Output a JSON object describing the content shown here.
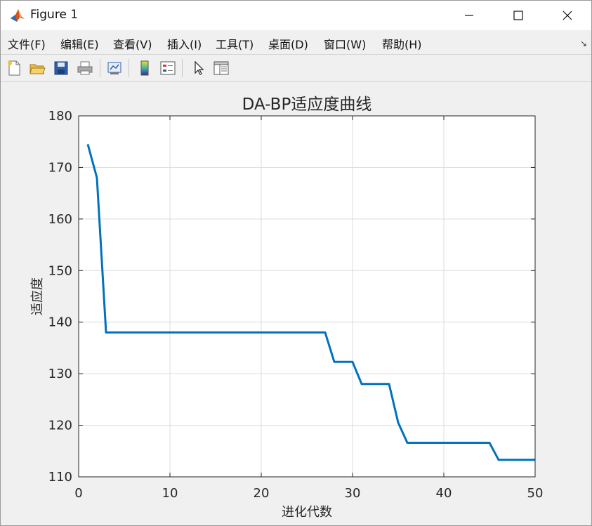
{
  "window": {
    "title": "Figure 1",
    "controls": {
      "minimize": "—",
      "maximize": "☐",
      "close": "✕"
    }
  },
  "menu": {
    "items": [
      "文件(F)",
      "编辑(E)",
      "查看(V)",
      "插入(I)",
      "工具(T)",
      "桌面(D)",
      "窗口(W)",
      "帮助(H)"
    ],
    "more_icon": "↘"
  },
  "toolbar": {
    "buttons": [
      "new-figure-icon",
      "open-file-icon",
      "save-icon",
      "print-icon",
      "link-plot-icon",
      "colorbar-icon",
      "legend-icon",
      "edit-plot-icon",
      "property-inspector-icon"
    ]
  },
  "colors": {
    "line": "#0072BD",
    "grid": "#dcdcdc",
    "axes_bg": "#ffffff",
    "figure_bg": "#f0f0f0"
  },
  "chart_data": {
    "type": "line",
    "title": "DA-BP适应度曲线",
    "xlabel": "进化代数",
    "ylabel": "适应度",
    "xlim": [
      0,
      50
    ],
    "ylim": [
      110,
      180
    ],
    "xticks": [
      0,
      10,
      20,
      30,
      40,
      50
    ],
    "yticks": [
      110,
      120,
      130,
      140,
      150,
      160,
      170,
      180
    ],
    "grid": true,
    "series": [
      {
        "x": [
          1,
          2,
          3,
          4,
          5,
          6,
          7,
          8,
          9,
          10,
          11,
          12,
          13,
          14,
          15,
          16,
          17,
          18,
          19,
          20,
          21,
          22,
          23,
          24,
          25,
          26,
          27,
          28,
          29,
          30,
          31,
          32,
          33,
          34,
          35,
          36,
          37,
          38,
          39,
          40,
          41,
          42,
          43,
          44,
          45,
          46,
          47,
          48,
          49,
          50
        ],
        "y": [
          174.5,
          168,
          138,
          138,
          138,
          138,
          138,
          138,
          138,
          138,
          138,
          138,
          138,
          138,
          138,
          138,
          138,
          138,
          138,
          138,
          138,
          138,
          138,
          138,
          138,
          138,
          138,
          132.3,
          132.3,
          132.3,
          128,
          128,
          128,
          128,
          120.5,
          116.6,
          116.6,
          116.6,
          116.6,
          116.6,
          116.6,
          116.6,
          116.6,
          116.6,
          116.6,
          113.3,
          113.3,
          113.3,
          113.3,
          113.3
        ]
      }
    ]
  }
}
